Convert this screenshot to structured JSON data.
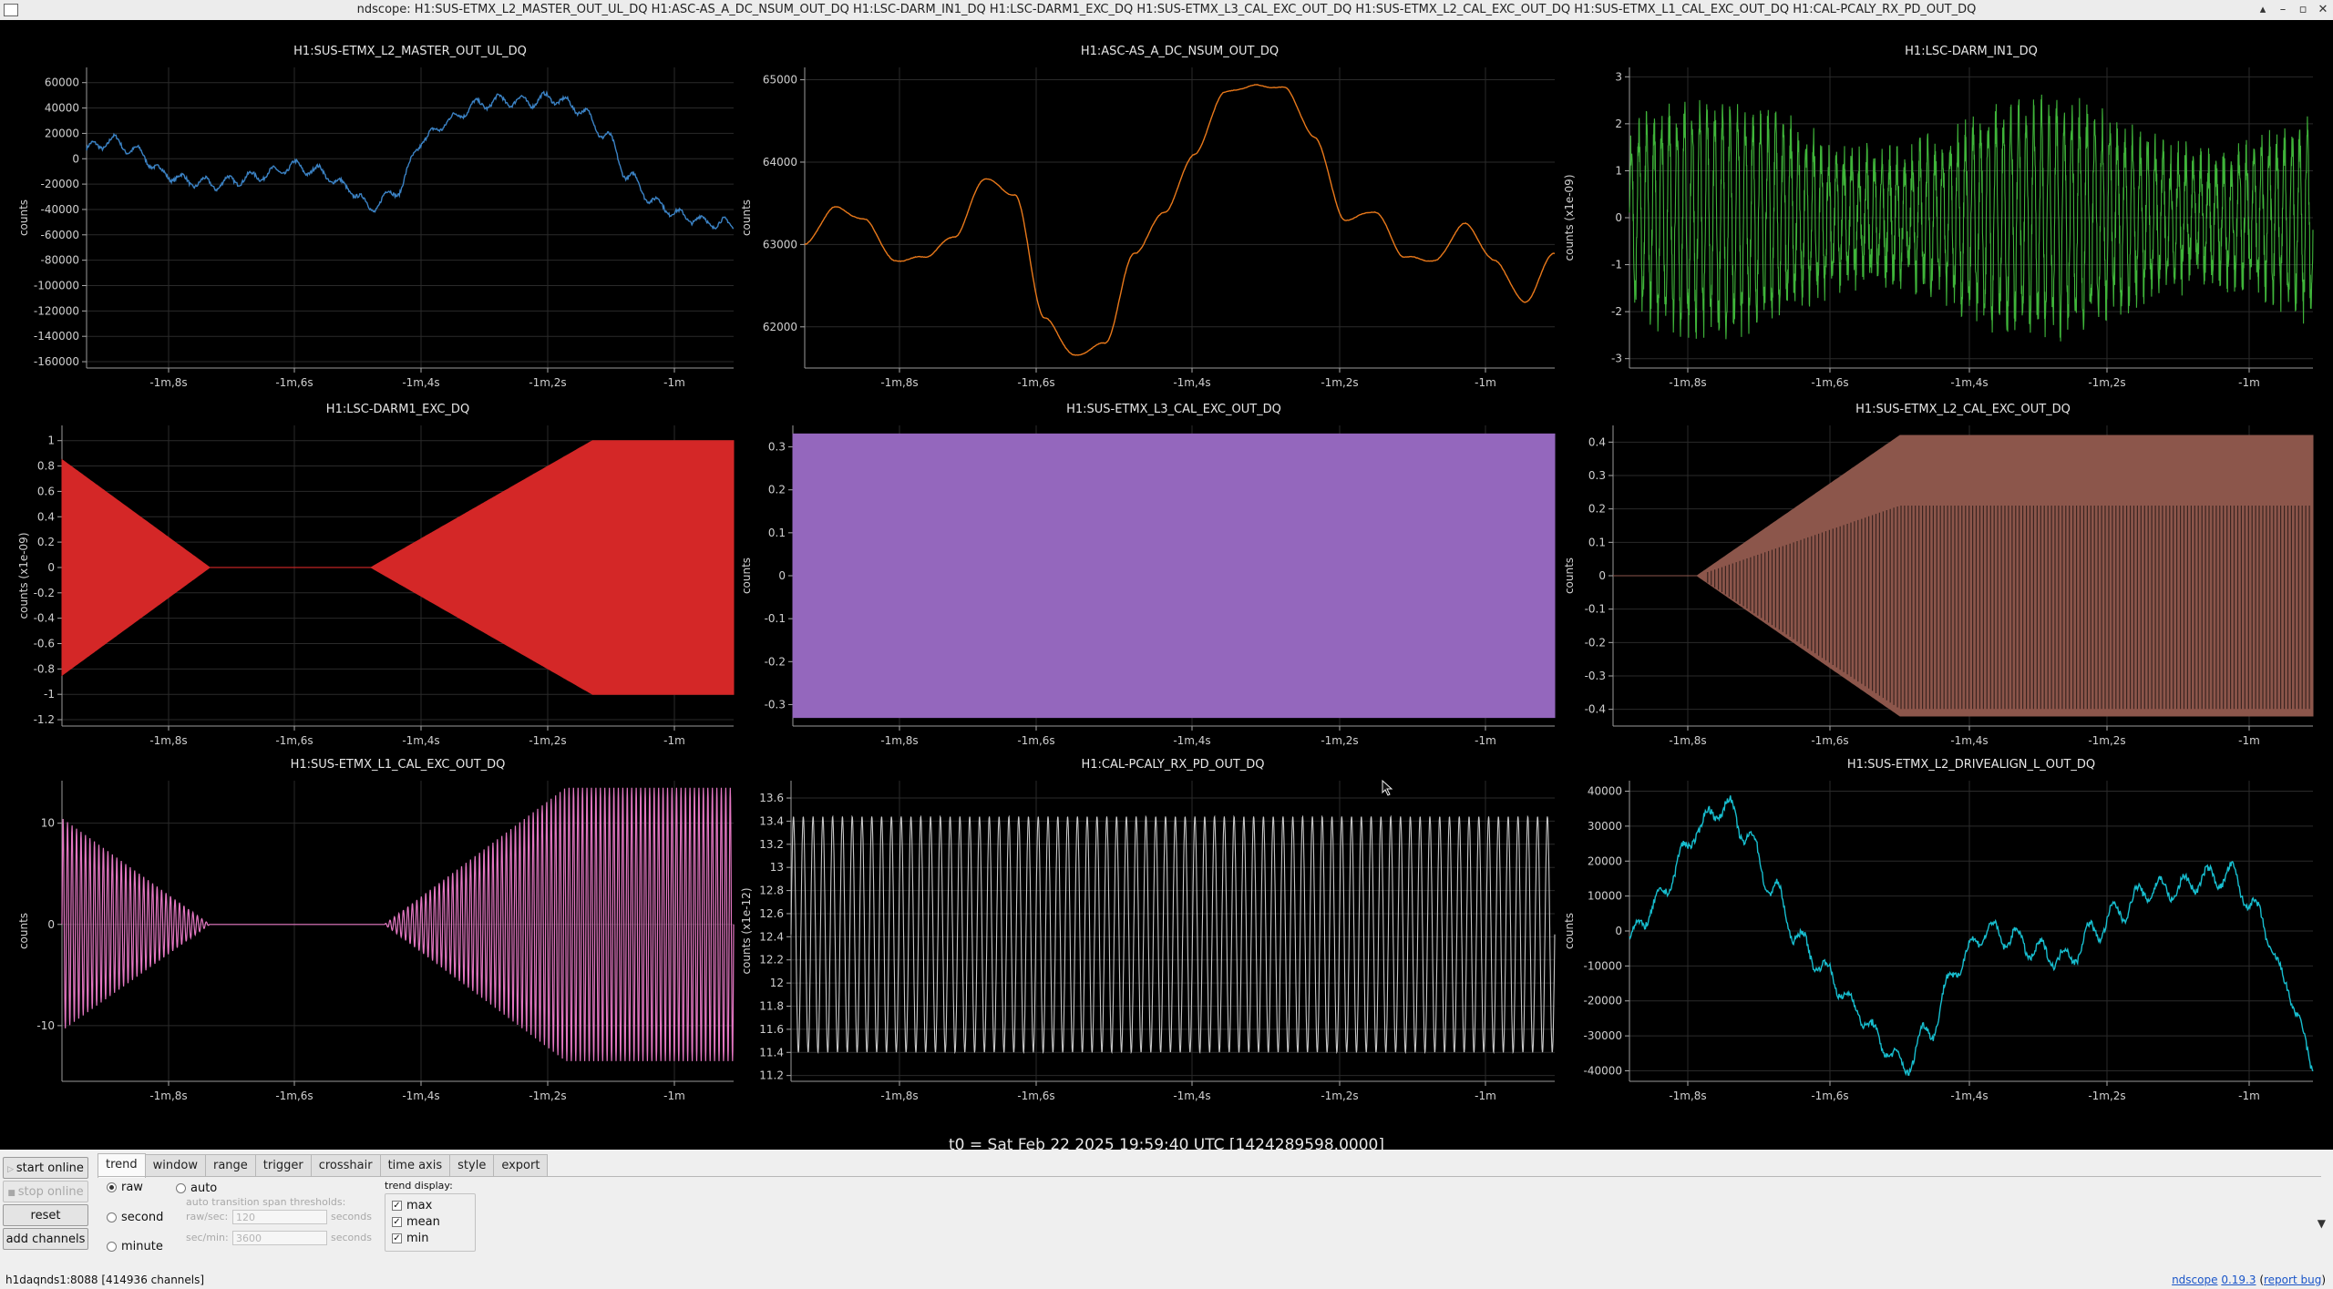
{
  "window": {
    "title": "ndscope: H1:SUS-ETMX_L2_MASTER_OUT_UL_DQ H1:ASC-AS_A_DC_NSUM_OUT_DQ H1:LSC-DARM_IN1_DQ H1:LSC-DARM1_EXC_DQ H1:SUS-ETMX_L3_CAL_EXC_OUT_DQ H1:SUS-ETMX_L2_CAL_EXC_OUT_DQ H1:SUS-ETMX_L1_CAL_EXC_OUT_DQ H1:CAL-PCALY_RX_PD_OUT_DQ",
    "minimize": "▴",
    "restore": "–",
    "maximize": "▫",
    "close": "✕"
  },
  "t0": "t0 = Sat Feb 22 2025 19:59:40 UTC [1424289598.0000]",
  "xticks": [
    "-1m,8s",
    "-1m,6s",
    "-1m,4s",
    "-1m,2s",
    "-1m"
  ],
  "chart_data": [
    {
      "type": "line",
      "title": "H1:SUS-ETMX_L2_MASTER_OUT_UL_DQ",
      "ylabel": "counts",
      "color": "#3b82c4",
      "ylim": [
        -165000,
        72000
      ],
      "yticks": [
        60000,
        40000,
        20000,
        0,
        -20000,
        -40000,
        -60000,
        -80000,
        -100000,
        -120000,
        -140000,
        -160000
      ],
      "ytick_labels": [
        "60000",
        "40000",
        "20000",
        "0",
        "-20000",
        "-40000",
        "-60000",
        "-80000",
        "-100000",
        "-120000",
        "-140000",
        "-160000"
      ],
      "x": [
        0,
        0.04,
        0.08,
        0.12,
        0.16,
        0.2,
        0.24,
        0.28,
        0.32,
        0.36,
        0.4,
        0.44,
        0.48,
        0.52,
        0.56,
        0.6,
        0.64,
        0.68,
        0.72,
        0.76,
        0.8,
        0.84,
        0.88,
        0.92,
        0.96,
        1.0
      ],
      "y": [
        8000,
        14000,
        5000,
        -12000,
        -18000,
        -20000,
        -16000,
        -12000,
        -6000,
        -10000,
        -22000,
        -38000,
        -25000,
        15000,
        30000,
        42000,
        46000,
        45000,
        48000,
        40000,
        20000,
        -15000,
        -35000,
        -45000,
        -50000,
        -52000
      ],
      "noise": 0.03
    },
    {
      "type": "line",
      "title": "H1:ASC-AS_A_DC_NSUM_OUT_DQ",
      "ylabel": "counts",
      "color": "#e8781a",
      "ylim": [
        61500,
        65150
      ],
      "yticks": [
        65000,
        64000,
        63000,
        62000
      ],
      "ytick_labels": [
        "65000",
        "64000",
        "63000",
        "62000"
      ],
      "x": [
        0,
        0.04,
        0.08,
        0.12,
        0.16,
        0.2,
        0.24,
        0.28,
        0.32,
        0.36,
        0.4,
        0.44,
        0.48,
        0.52,
        0.56,
        0.6,
        0.64,
        0.68,
        0.72,
        0.76,
        0.8,
        0.84,
        0.88,
        0.92,
        0.96,
        1.0
      ],
      "y": [
        63000,
        63450,
        63300,
        62800,
        62850,
        63100,
        63800,
        63600,
        62100,
        61650,
        61800,
        62900,
        63400,
        64100,
        64850,
        64930,
        64900,
        64300,
        63300,
        63400,
        62850,
        62800,
        63250,
        62800,
        62300,
        62900
      ],
      "noise": 0.004
    },
    {
      "type": "line",
      "title": "H1:LSC-DARM_IN1_DQ",
      "ylabel": "counts (x1e-09)",
      "color": "#3fb43a",
      "ylim": [
        -3.2,
        3.2
      ],
      "yticks": [
        3,
        2,
        1,
        0,
        -1,
        -2,
        -3
      ],
      "ytick_labels": [
        "3",
        "2",
        "1",
        "0",
        "-1",
        "-2",
        "-3"
      ],
      "cycles": 90,
      "amplitude": 2.2,
      "noise": 0.5
    },
    {
      "type": "area",
      "title": "H1:LSC-DARM1_EXC_DQ",
      "ylabel": "counts (x1e-09)",
      "color": "#d42727",
      "ylim": [
        -1.25,
        1.12
      ],
      "yticks": [
        1,
        0.8,
        0.6,
        0.4,
        0.2,
        0,
        -0.2,
        -0.4,
        -0.6,
        -0.8,
        -1,
        -1.2
      ],
      "ytick_labels": [
        "1",
        "0.8",
        "0.6",
        "0.4",
        "0.2",
        "0",
        "-0.2",
        "-0.4",
        "-0.6",
        "-0.8",
        "-1",
        "-1.2"
      ],
      "envelope_x": [
        0,
        0.22,
        0.46,
        0.79,
        1.0
      ],
      "envelope_y": [
        0.85,
        0,
        0,
        1.0,
        1.0
      ]
    },
    {
      "type": "area",
      "title": "H1:SUS-ETMX_L3_CAL_EXC_OUT_DQ",
      "ylabel": "counts",
      "color": "#9467bd",
      "ylim": [
        -0.35,
        0.35
      ],
      "yticks": [
        0.3,
        0.2,
        0.1,
        0,
        -0.1,
        -0.2,
        -0.3
      ],
      "ytick_labels": [
        "0.3",
        "0.2",
        "0.1",
        "0",
        "-0.1",
        "-0.2",
        "-0.3"
      ],
      "envelope_x": [
        0,
        1.0
      ],
      "envelope_y": [
        0.33,
        0.33
      ]
    },
    {
      "type": "area",
      "title": "H1:SUS-ETMX_L2_CAL_EXC_OUT_DQ",
      "ylabel": "counts",
      "color": "#8c564b",
      "ylim": [
        -0.45,
        0.45
      ],
      "yticks": [
        0.4,
        0.3,
        0.2,
        0.1,
        0,
        -0.1,
        -0.2,
        -0.3,
        -0.4
      ],
      "ytick_labels": [
        "0.4",
        "0.3",
        "0.2",
        "0.1",
        "0",
        "-0.1",
        "-0.2",
        "-0.3",
        "-0.4"
      ],
      "envelope_x": [
        0,
        0.12,
        0.41,
        1.0
      ],
      "envelope_y": [
        0,
        0,
        0.42,
        0.42
      ],
      "striped": true
    },
    {
      "type": "line",
      "title": "H1:SUS-ETMX_L1_CAL_EXC_OUT_DQ",
      "ylabel": "counts",
      "color": "#e377c2",
      "ylim": [
        -15.5,
        14.2
      ],
      "yticks": [
        10,
        0,
        -10
      ],
      "ytick_labels": [
        "10",
        "0",
        "-10"
      ],
      "envelope_x": [
        0,
        0.22,
        0.48,
        0.75,
        1.0
      ],
      "envelope_y": [
        10.5,
        0,
        0,
        13.5,
        13.5
      ],
      "cycles": 150
    },
    {
      "type": "line",
      "title": "H1:CAL-PCALY_RX_PD_OUT_DQ",
      "ylabel": "counts (x1e-12)",
      "color": "#c8c8c8",
      "ylim": [
        11.15,
        13.75
      ],
      "yticks": [
        13.6,
        13.4,
        13.2,
        13,
        12.8,
        12.6,
        12.4,
        12.2,
        12,
        11.8,
        11.6,
        11.4,
        11.2
      ],
      "ytick_labels": [
        "13.6",
        "13.4",
        "13.2",
        "13",
        "12.8",
        "12.6",
        "12.4",
        "12.2",
        "12",
        "11.8",
        "11.6",
        "11.4",
        "11.2"
      ],
      "cycles": 78,
      "center": 12.42,
      "amplitude": 1.02
    },
    {
      "type": "line",
      "title": "H1:SUS-ETMX_L2_DRIVEALIGN_L_OUT_DQ",
      "ylabel": "counts",
      "color": "#17becf",
      "ylim": [
        -43000,
        43000
      ],
      "yticks": [
        40000,
        30000,
        20000,
        10000,
        0,
        -10000,
        -20000,
        -30000,
        -40000
      ],
      "ytick_labels": [
        "40000",
        "30000",
        "20000",
        "10000",
        "0",
        "-10000",
        "-20000",
        "-30000",
        "-40000"
      ],
      "x": [
        0,
        0.04,
        0.08,
        0.1,
        0.14,
        0.17,
        0.21,
        0.25,
        0.29,
        0.33,
        0.37,
        0.4,
        0.44,
        0.48,
        0.52,
        0.56,
        0.6,
        0.64,
        0.68,
        0.72,
        0.76,
        0.8,
        0.84,
        0.88,
        0.92,
        0.96,
        1.0
      ],
      "y": [
        -2000,
        8000,
        22000,
        30000,
        36000,
        28000,
        12000,
        -3000,
        -12000,
        -22000,
        -32000,
        -39000,
        -28000,
        -10000,
        0,
        -2000,
        -6000,
        -8000,
        0,
        6000,
        12000,
        12000,
        15000,
        16000,
        5000,
        -15000,
        -38000
      ],
      "noise": 0.06
    }
  ],
  "controls": {
    "start_online": "start online",
    "stop_online": "stop online",
    "reset": "reset",
    "add_channels": "add channels",
    "tabs": [
      "trend",
      "window",
      "range",
      "trigger",
      "crosshair",
      "time axis",
      "style",
      "export"
    ],
    "active_tab": "trend",
    "trend": {
      "raw": "raw",
      "second": "second",
      "minute": "minute",
      "auto": "auto",
      "threshold_title": "auto transition span thresholds:",
      "raw_sec_label": "raw/sec:",
      "raw_sec_value": "120",
      "raw_sec_unit": "seconds",
      "sec_min_label": "sec/min:",
      "sec_min_value": "3600",
      "sec_min_unit": "seconds",
      "display_label": "trend display:",
      "max": "max",
      "mean": "mean",
      "min": "min",
      "expand_icon": "▼"
    }
  },
  "status": {
    "server": "h1daqnds1:8088  [414936 channels]",
    "app_name": "ndscope",
    "version": "0.19.3",
    "report_bug": "report bug"
  }
}
